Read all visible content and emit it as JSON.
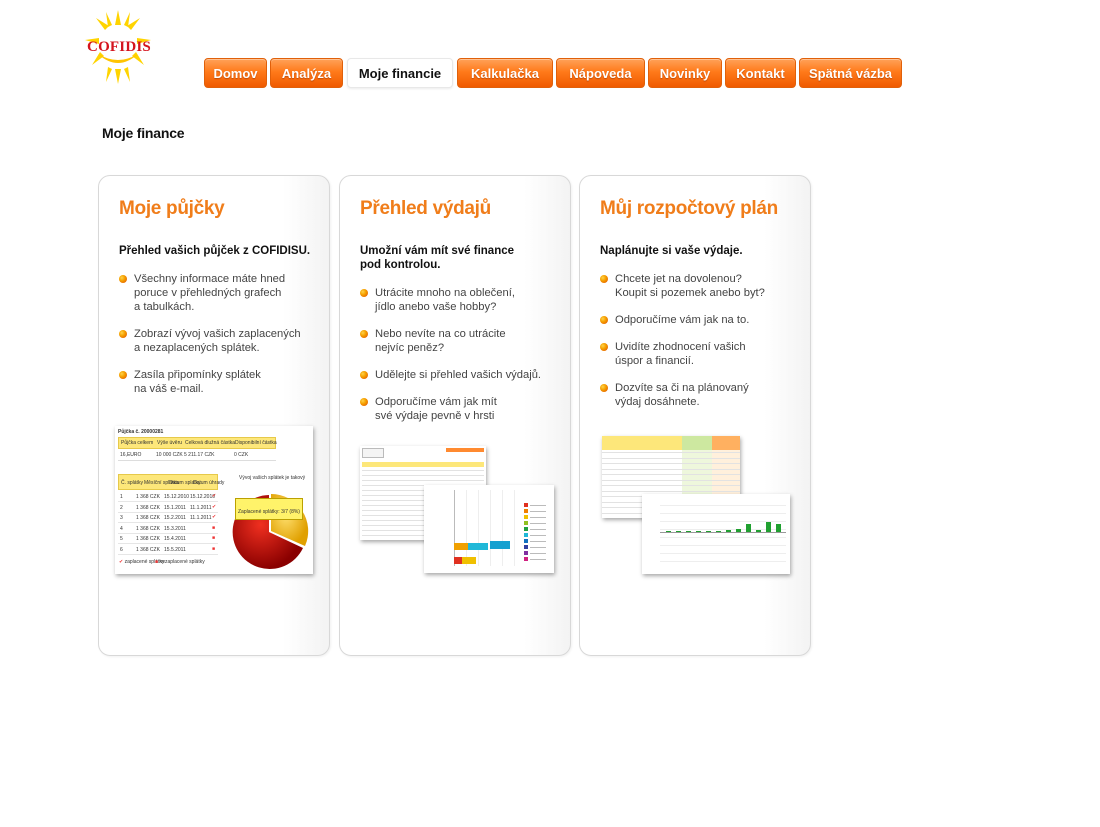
{
  "logo": {
    "text": "COFIDIS"
  },
  "nav": {
    "tabs": [
      {
        "label": "Domov",
        "active": false
      },
      {
        "label": "Analýza",
        "active": false
      },
      {
        "label": "Moje financie",
        "active": true
      },
      {
        "label": "Kalkulačka",
        "active": false
      },
      {
        "label": "Nápoveda",
        "active": false
      },
      {
        "label": "Novinky",
        "active": false
      },
      {
        "label": "Kontakt",
        "active": false
      },
      {
        "label": "Spätná vázba",
        "active": false
      }
    ]
  },
  "page_title": "Moje finance",
  "cards": [
    {
      "title": "Moje půjčky",
      "intro": "Přehled vašich půjček z COFIDISU.",
      "bullets": [
        "Všechny informace máte hned\nporuce v přehledných grafech\na tabulkách.",
        "Zobrazí vývoj vašich zaplacených\na nezaplacených splátek.",
        "Zasíla připomínky splátek\nna váš e-mail."
      ]
    },
    {
      "title": "Přehled výdajů",
      "intro": "Umožní vám mít své finance\npod kontrolou.",
      "bullets": [
        "Utrácite mnoho na oblečení,\njídlo anebo vaše hobby?",
        "Nebo nevíte na co utrácite\nnejvíc peněz?",
        "Udělejte si přehled vašich výdajů.",
        "Odporučíme vám jak mít\nsvé výdaje pevně v hrsti"
      ]
    },
    {
      "title": "Můj rozpočtový plán",
      "intro": "Naplánujte si vaše výdaje.",
      "bullets": [
        "Chcete jet  na dovolenou?\nKoupit si pozemek anebo byt?",
        "Odporučíme vám jak na to.",
        "Uvidíte zhodnocení vašich\núspor a financií.",
        "Dozvíte sa či na plánovaný\nvýdaj dosáhnete."
      ]
    }
  ],
  "loan_thumb": {
    "title": "Půjčka č. 20000281",
    "headers": [
      "Půjčka celkem",
      "Výše úvěru",
      "Celková dlužná částka",
      "Disponibilní částka"
    ],
    "row": [
      "16,EURO",
      "10 000 CZK",
      "5 211.17 CZK",
      "0 CZK"
    ],
    "sched_headers": [
      "Č. splátky",
      "Měsíční splátka",
      "Datum splatky",
      "Datum úhrady"
    ],
    "sched_rows": [
      [
        "1",
        "1 368 CZK",
        "15.12.2010",
        "15.12.2010"
      ],
      [
        "2",
        "1 368 CZK",
        "15.1.2011",
        "11.1.2011"
      ],
      [
        "3",
        "1 368 CZK",
        "15.2.2011",
        "11.1.2011"
      ],
      [
        "4",
        "1 368 CZK",
        "15.3.2011",
        ""
      ],
      [
        "5",
        "1 368 CZK",
        "15.4.2011",
        ""
      ],
      [
        "6",
        "1 368 CZK",
        "15.5.2011",
        ""
      ]
    ],
    "pie_title": "Vývoj vašich splátek je takový",
    "pie_label": "Zaplacené splátky: 3/7 (8%)",
    "legend": [
      "zaplacené splátky",
      "nezaplacené splátky"
    ]
  },
  "colors": {
    "accent_orange": "#f07d1a",
    "tab_orange": "#ff7a1a",
    "logo_red": "#d4141e",
    "sun_yellow": "#ffd400"
  }
}
